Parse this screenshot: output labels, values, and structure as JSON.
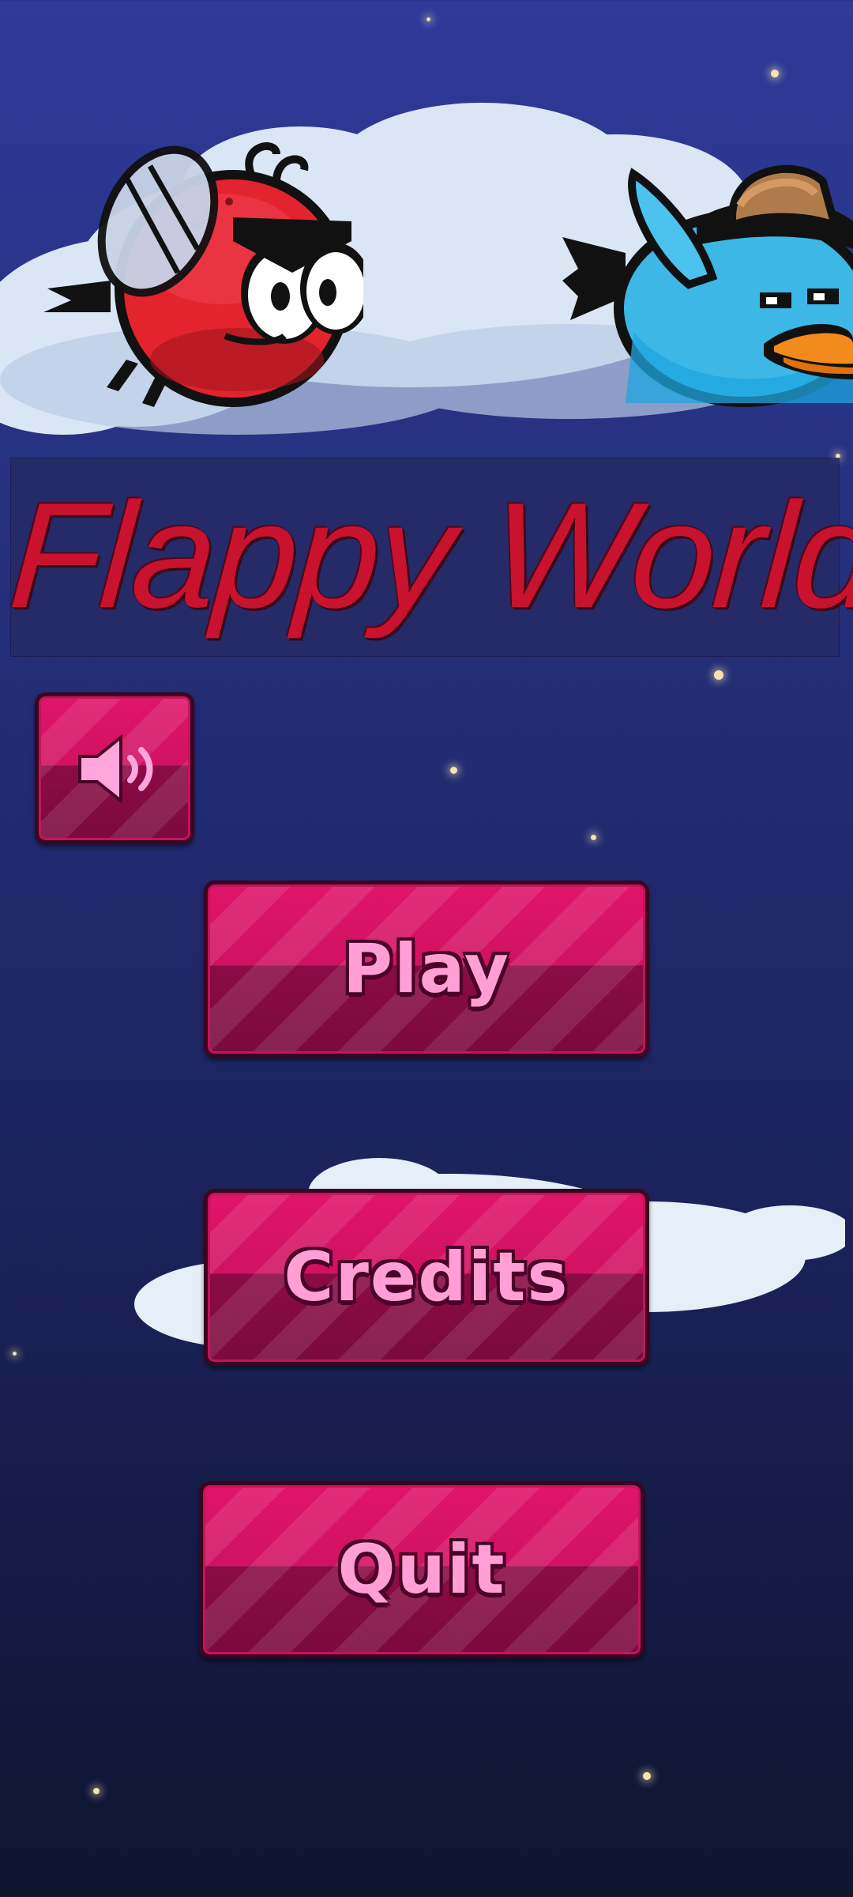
{
  "game": {
    "title": "Flappy World"
  },
  "menu": {
    "sound_icon": "speaker-icon",
    "play_label": "Play",
    "credits_label": "Credits",
    "quit_label": "Quit"
  },
  "colors": {
    "title": "#c8122e",
    "button": "#d01262",
    "button_text": "#ff9fd6",
    "sky_top": "#2f3a9a",
    "sky_bottom": "#10152f"
  }
}
